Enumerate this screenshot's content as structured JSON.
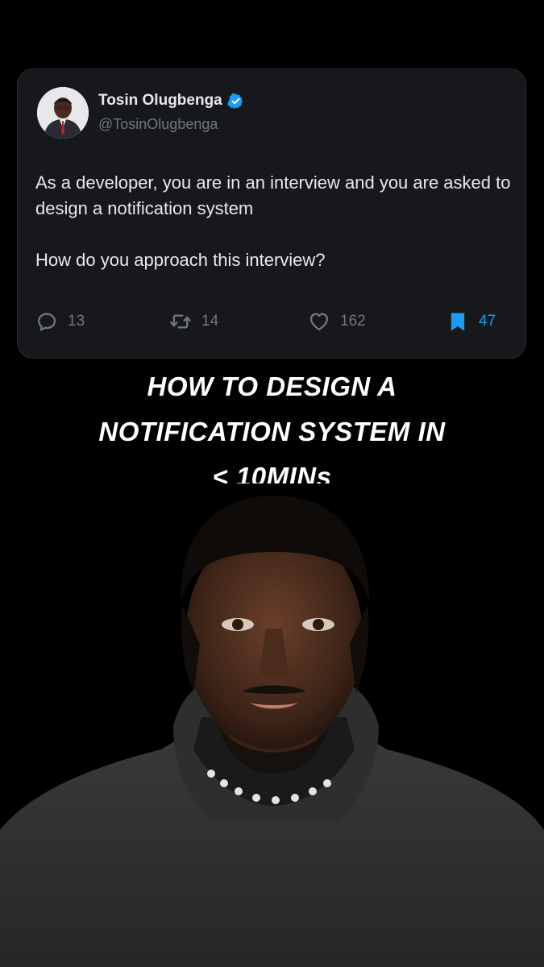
{
  "tweet": {
    "author_name": "Tosin Olugbenga",
    "author_handle": "@TosinOlugbenga",
    "verified_icon": "verified-badge-icon",
    "text_lines": [
      "As a developer, you are in an interview and you are asked to design a notification system",
      "How do you approach this interview?"
    ],
    "actions": {
      "replies": "13",
      "retweets": "14",
      "likes": "162",
      "bookmarks": "47"
    }
  },
  "overlay": {
    "headline_lines": [
      "HOW TO DESIGN A",
      "NOTIFICATION SYSTEM IN",
      "< 10MINs"
    ]
  },
  "colors": {
    "background": "#000000",
    "card": "#16181c",
    "text_primary": "#e7e9ea",
    "text_secondary": "#71767b",
    "accent": "#1d9bf0"
  }
}
